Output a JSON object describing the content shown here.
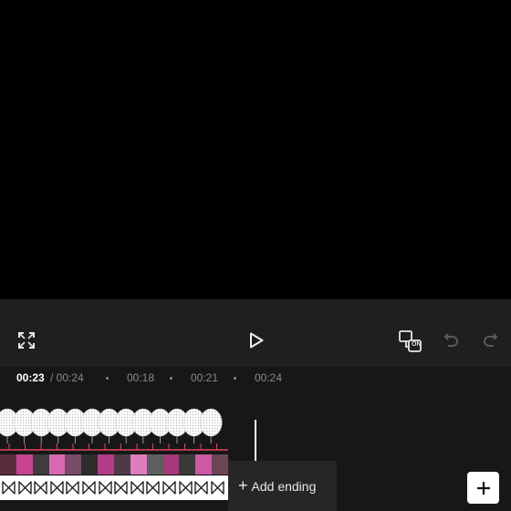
{
  "preview": {
    "background": "#000000"
  },
  "controls": {
    "fullscreen_icon": "expand-icon",
    "play_icon": "play-icon",
    "compare_icon": "compare-icon",
    "compare_badge": "ON",
    "undo_icon": "undo-icon",
    "redo_icon": "redo-icon"
  },
  "timeline": {
    "current_time": "00:23",
    "total_time": "/ 00:24",
    "ticks": [
      "00:18",
      "00:21",
      "00:24"
    ],
    "add_ending_label": "Add ending",
    "add_ending_plus": "+",
    "add_track_label": "+"
  },
  "colors": {
    "accent_line": "#e0475b",
    "frame_pink": "#c7438f"
  }
}
